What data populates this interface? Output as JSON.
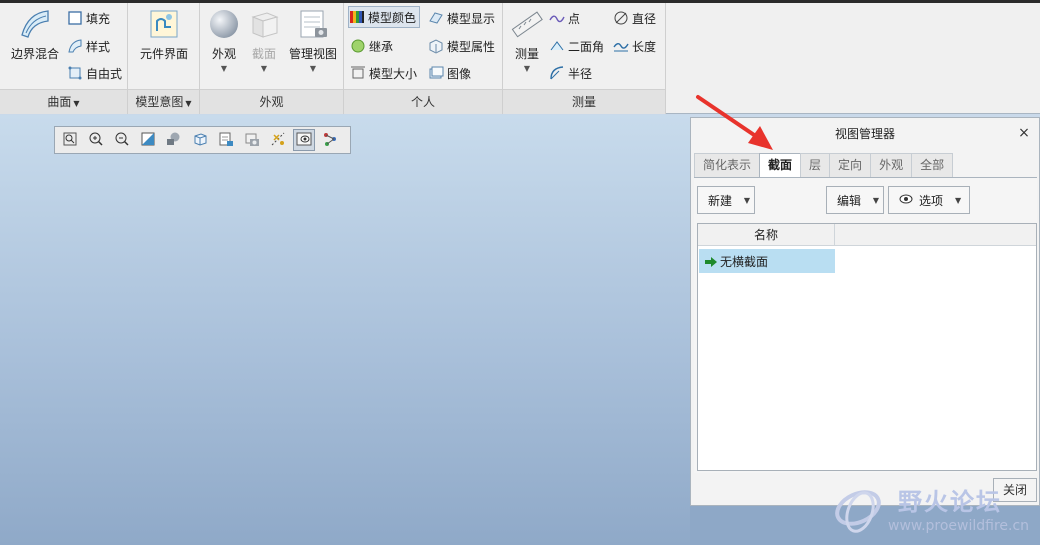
{
  "ribbon": {
    "groups": [
      {
        "label": "曲面",
        "has_dropdown": true
      },
      {
        "label": "模型意图",
        "has_dropdown": true
      },
      {
        "label": "外观",
        "has_dropdown": false
      },
      {
        "label": "个人",
        "has_dropdown": false
      },
      {
        "label": "测量",
        "has_dropdown": false
      }
    ],
    "surface": {
      "boundary_blend": "边界混合",
      "fill": "填充",
      "style": "样式",
      "freestyle": "自由式"
    },
    "model_intent": {
      "component_interface": "元件界面"
    },
    "appearance": {
      "appearance": "外观",
      "section": "截面",
      "manage_views": "管理视图"
    },
    "personal": {
      "model_color": "模型颜色",
      "model_display": "模型显示",
      "inherit": "继承",
      "model_properties": "模型属性",
      "model_size": "模型大小",
      "image": "图像"
    },
    "measure": {
      "measure": "测量",
      "point": "点",
      "diameter": "直径",
      "dihedral": "二面角",
      "length": "长度",
      "radius": "半径"
    }
  },
  "view_manager": {
    "title": "视图管理器",
    "tabs": [
      "简化表示",
      "截面",
      "层",
      "定向",
      "外观",
      "全部"
    ],
    "active_tab": "截面",
    "new_button": "新建",
    "edit_button": "编辑",
    "options_button": "选项",
    "table_header": "名称",
    "rows": [
      "无横截面"
    ],
    "close_button": "关闭"
  },
  "watermark": {
    "title": "野火论坛",
    "url": "www.proewildfire.cn"
  },
  "colors": {
    "ribbon_bg": "#f0f0f0",
    "selected_row": "#b9def2",
    "annotation_arrow": "#e8332c"
  }
}
